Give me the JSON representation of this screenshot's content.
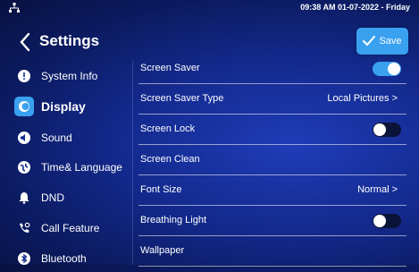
{
  "status": {
    "datetime": "09:38 AM  01-07-2022 - Friday",
    "icon": "network-icon"
  },
  "header": {
    "title": "Settings",
    "save_label": "Save"
  },
  "sidebar": {
    "items": [
      {
        "label": "System Info",
        "icon": "info-icon"
      },
      {
        "label": "Display",
        "icon": "display-icon",
        "active": true
      },
      {
        "label": "Sound",
        "icon": "speaker-icon"
      },
      {
        "label": "Time& Language",
        "icon": "globe-icon"
      },
      {
        "label": "DND",
        "icon": "bell-icon"
      },
      {
        "label": "Call Feature",
        "icon": "phone-gear-icon"
      },
      {
        "label": "Bluetooth",
        "icon": "bluetooth-icon"
      }
    ]
  },
  "settings": {
    "screen_saver": {
      "label": "Screen Saver",
      "on": true
    },
    "screen_saver_type": {
      "label": "Screen Saver Type",
      "value": "Local Pictures  >"
    },
    "screen_lock": {
      "label": "Screen Lock",
      "on": false
    },
    "screen_clean": {
      "label": "Screen Clean"
    },
    "font_size": {
      "label": "Font Size",
      "value": "Normal  >"
    },
    "breathing_light": {
      "label": "Breathing Light",
      "on": false
    },
    "wallpaper": {
      "label": "Wallpaper"
    }
  },
  "colors": {
    "accent": "#3aa0f0",
    "background": "#142a8f"
  }
}
